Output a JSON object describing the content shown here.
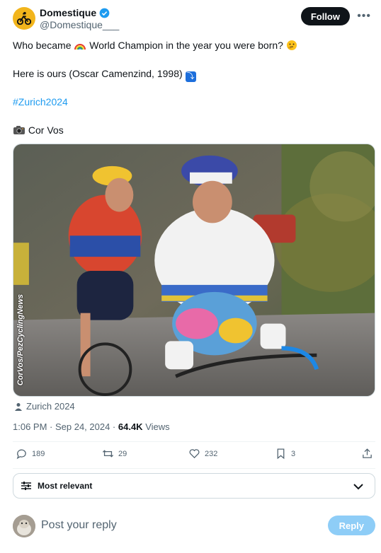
{
  "author": {
    "display_name": "Domestique",
    "handle": "@Domestique___",
    "follow_label": "Follow"
  },
  "tweet": {
    "line1_before": "Who became ",
    "line1_after": " World Champion in the year you were born? ",
    "line2": "Here is ours (Oscar Camenzind, 1998) ",
    "hashtag": "#Zurich2024",
    "credit": " Cor Vos"
  },
  "photo": {
    "watermark": "CorVos/PezCyclingNews"
  },
  "location": "Zurich 2024",
  "meta": {
    "time": "1:06 PM · Sep 24, 2024 · ",
    "views_count": "64.4K",
    "views_label": " Views"
  },
  "actions": {
    "replies": "189",
    "retweets": "29",
    "likes": "232",
    "bookmarks": "3"
  },
  "sort": {
    "label": "Most relevant"
  },
  "reply": {
    "placeholder": "Post your reply",
    "button_label": "Reply"
  },
  "colors": {
    "accent": "#1d9bf0",
    "follow_bg": "#0f1419",
    "reply_button_disabled": "#8ecdf7"
  }
}
